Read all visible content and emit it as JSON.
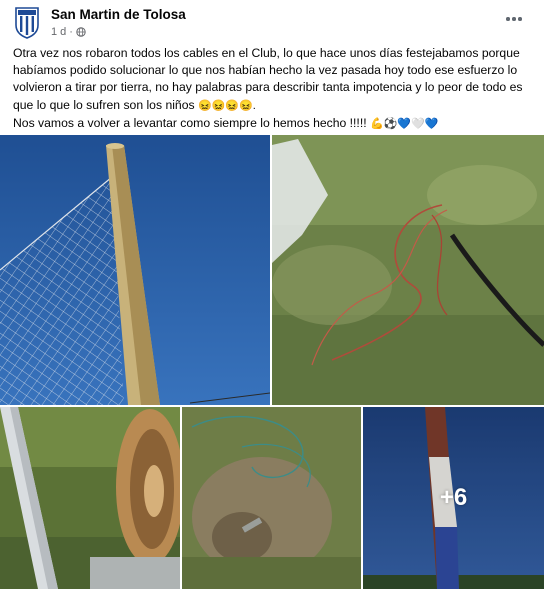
{
  "post": {
    "page_name": "San Martin de Tolosa",
    "time": "1 d",
    "separator": "·",
    "text_lines": [
      "Otra vez nos robaron todos los cables en el Club, lo que hace unos días festejabamos porque habíamos podido solucionar lo que nos habían hecho la vez pasada hoy todo ese esfuerzo lo volvieron a tirar por tierra, no hay palabras para describir tanta impotencia y lo peor de todo es que lo que lo sufren son los niños ",
      "Nos vamos a volver a levantar como siempre lo hemos hecho !!!!! "
    ],
    "line1_emojis": "😖😖😖😖.",
    "line2_emojis": "💪⚽💙🤍💙"
  },
  "gallery": {
    "more_count": "+6"
  },
  "icons": {
    "avatar": "club-crest-icon",
    "privacy": "globe-icon",
    "menu": "more-options-icon"
  },
  "colors": {
    "text_primary": "#050505",
    "text_secondary": "#65676b",
    "crest_blue": "#1e4a96"
  }
}
